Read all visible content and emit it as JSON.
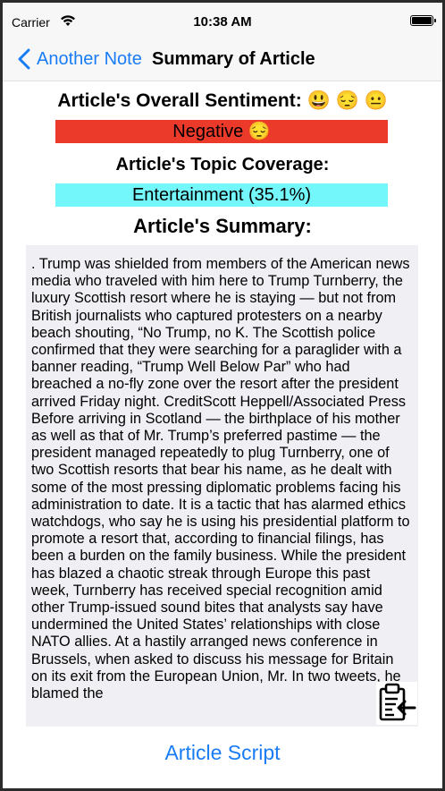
{
  "status_bar": {
    "carrier": "Carrier",
    "time": "10:38 AM",
    "wifi_icon": "wifi-icon",
    "battery_icon": "battery-full-icon"
  },
  "nav": {
    "back_label": "Another Note",
    "back_icon": "chevron-left-icon",
    "title": "Summary of Article",
    "accent": "#1a7cf5"
  },
  "sentiment": {
    "heading": "Article's Overall Sentiment: 😃 😔 😐",
    "value": "Negative 😔",
    "color": "#ec3a2a"
  },
  "topic": {
    "heading": "Article's Topic Coverage:",
    "value": "Entertainment (35.1%)",
    "color": "#73f7fb"
  },
  "summary": {
    "heading": "Article's Summary:",
    "text": ".  Trump was shielded from members of the American news media who traveled with him here to Trump Turnberry, the luxury Scottish resort where he is staying — but not from British journalists who captured protesters on a nearby beach shouting, “No Trump, no K.  The Scottish police confirmed that they were searching for a paraglider with a banner reading, “Trump Well Below Par” who had breached a no-fly zone over the resort after the president arrived Friday night. CreditScott Heppell/Associated Press Before arriving in Scotland — the birthplace of his mother as well as that of Mr.  Trump’s preferred pastime — the president managed repeatedly to plug Turnberry, one of two Scottish resorts that bear his name, as he dealt with some of the most pressing diplomatic problems facing his administration to date.  It is a tactic that has alarmed ethics watchdogs, who say he is using his presidential platform to promote a resort that, according to financial filings, has been a burden on the family business.  While the president has blazed a chaotic streak through Europe this past week, Turnberry has received special recognition amid other Trump-issued sound bites that analysts say have undermined the United States’ relationships with close NATO allies.  At a hastily arranged news conference in Brussels, when asked to discuss his message for Britain on its exit from the European Union, Mr.  In two tweets, he blamed the",
    "paste_icon": "clipboard-paste-icon"
  },
  "footer": {
    "script_button": "Article Script"
  }
}
